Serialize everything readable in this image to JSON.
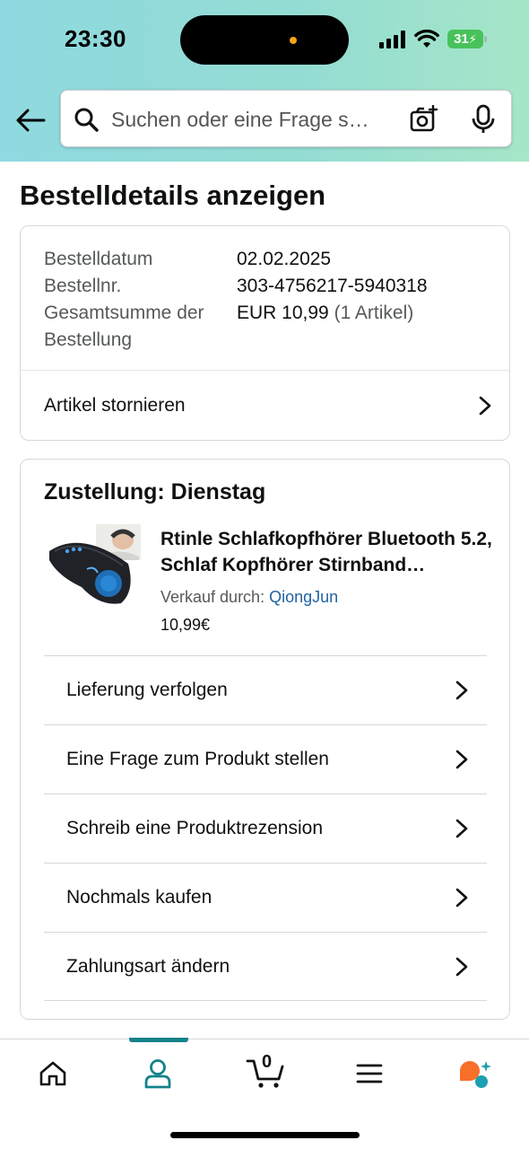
{
  "status_bar": {
    "time": "23:30",
    "battery": "31"
  },
  "search": {
    "placeholder": "Suchen oder eine Frage s…"
  },
  "page": {
    "title": "Bestelldetails anzeigen"
  },
  "order_summary": {
    "rows": [
      {
        "label": "Bestelldatum",
        "value": "02.02.2025",
        "extra": ""
      },
      {
        "label": "Bestellnr.",
        "value": "303-4756217-5940318",
        "extra": ""
      },
      {
        "label": "Gesamtsumme der Bestellung",
        "value": "EUR 10,99",
        "extra": "(1 Artikel)"
      }
    ],
    "cancel_label": "Artikel stornieren"
  },
  "delivery": {
    "title": "Zustellung: Dienstag",
    "product": {
      "title": "Rtinle Schlafkopfhörer Bluetooth 5.2, Schlaf Kopfhörer Stirnband…",
      "seller_prefix": "Verkauf durch:",
      "seller_name": "QiongJun",
      "price": "10,99€"
    },
    "actions": [
      {
        "label": "Lieferung verfolgen"
      },
      {
        "label": "Eine Frage zum Produkt stellen"
      },
      {
        "label": "Schreib eine Produktrezension"
      },
      {
        "label": "Nochmals kaufen"
      },
      {
        "label": "Zahlungsart ändern"
      }
    ]
  },
  "bottom_nav": {
    "cart_count": "0",
    "items": [
      "home-icon",
      "account-icon",
      "cart-icon",
      "menu-icon",
      "rufus-icon"
    ],
    "active": "account-icon"
  },
  "colors": {
    "accent": "#14838a",
    "link": "#2162a1",
    "header_start": "#8fd9e0",
    "header_end": "#a6e6c8"
  }
}
